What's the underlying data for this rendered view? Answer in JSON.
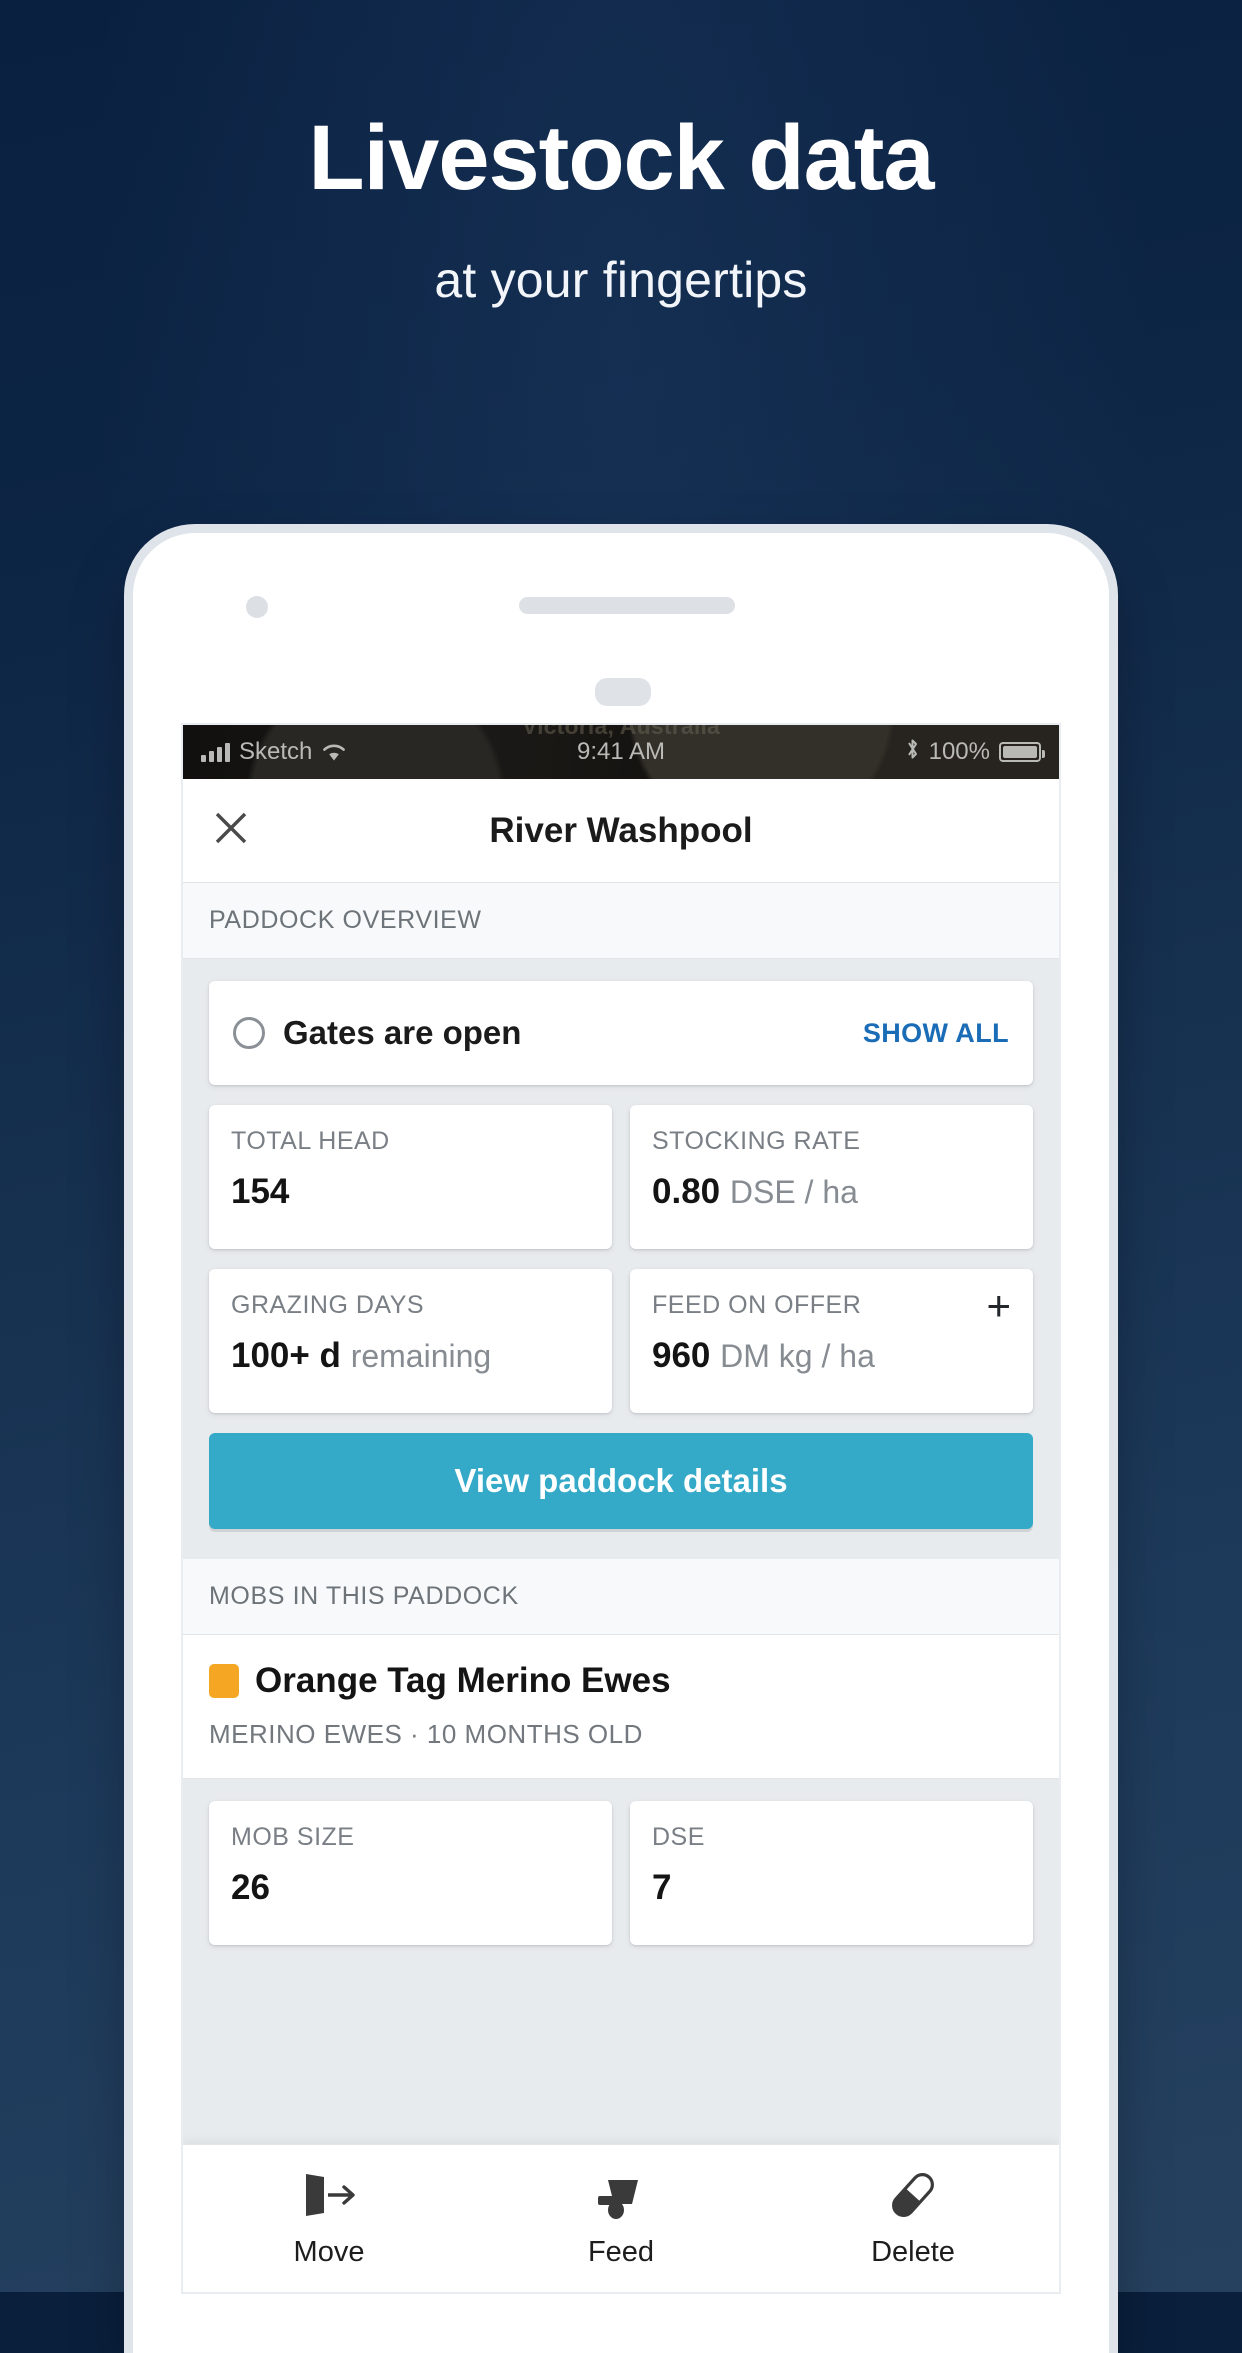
{
  "hero": {
    "title": "Livestock data",
    "subtitle": "at your fingertips"
  },
  "colors": {
    "background_top": "#0a2040",
    "background_bottom": "#26415f",
    "accent_teal": "#34aac8",
    "link_blue": "#1a6cb7",
    "mob_swatch_orange": "#f5a623",
    "panel_grey": "#e8ebee"
  },
  "statusbar": {
    "carrier": "Sketch",
    "wifi_icon": "wifi-icon",
    "signal_icon": "signal-bars-icon",
    "time": "9:41 AM",
    "bluetooth_icon": "bluetooth-icon",
    "battery_percent": "100%",
    "battery_icon": "battery-full-icon",
    "ghost_map_label": "Victoria, Australia"
  },
  "navbar": {
    "close_icon": "close-icon",
    "title": "River Washpool"
  },
  "sections": {
    "paddock_overview_header": "PADDOCK OVERVIEW",
    "mobs_header": "MOBS IN THIS PADDOCK"
  },
  "gates": {
    "status_icon": "circle-outline-icon",
    "label": "Gates are open",
    "show_all": "SHOW ALL"
  },
  "paddock_stats": [
    {
      "label": "TOTAL HEAD",
      "value": "154",
      "unit": ""
    },
    {
      "label": "STOCKING RATE",
      "value": "0.80",
      "unit": "DSE / ha"
    },
    {
      "label": "GRAZING DAYS",
      "value": "100+ d",
      "unit": "remaining"
    },
    {
      "label": "FEED ON OFFER",
      "value": "960",
      "unit": "DM kg / ha",
      "add_icon": "plus-icon"
    }
  ],
  "cta": {
    "label": "View paddock details"
  },
  "mob": {
    "swatch_color": "#f5a623",
    "name": "Orange Tag Merino Ewes",
    "meta": "MERINO EWES  ·  10 MONTHS OLD",
    "stats": [
      {
        "label": "MOB SIZE",
        "value": "26"
      },
      {
        "label": "DSE",
        "value": "7"
      }
    ]
  },
  "actions": [
    {
      "icon": "move-gate-arrow-icon",
      "label": "Move"
    },
    {
      "icon": "feed-trough-icon",
      "label": "Feed"
    },
    {
      "icon": "pill-capsule-icon",
      "label": "Delete"
    }
  ]
}
